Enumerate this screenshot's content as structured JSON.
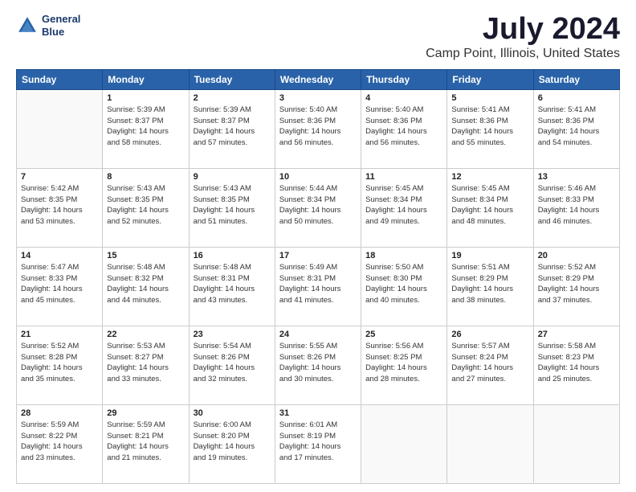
{
  "header": {
    "logo_line1": "General",
    "logo_line2": "Blue",
    "title": "July 2024",
    "subtitle": "Camp Point, Illinois, United States"
  },
  "weekdays": [
    "Sunday",
    "Monday",
    "Tuesday",
    "Wednesday",
    "Thursday",
    "Friday",
    "Saturday"
  ],
  "weeks": [
    [
      {
        "day": "",
        "info": ""
      },
      {
        "day": "1",
        "info": "Sunrise: 5:39 AM\nSunset: 8:37 PM\nDaylight: 14 hours\nand 58 minutes."
      },
      {
        "day": "2",
        "info": "Sunrise: 5:39 AM\nSunset: 8:37 PM\nDaylight: 14 hours\nand 57 minutes."
      },
      {
        "day": "3",
        "info": "Sunrise: 5:40 AM\nSunset: 8:36 PM\nDaylight: 14 hours\nand 56 minutes."
      },
      {
        "day": "4",
        "info": "Sunrise: 5:40 AM\nSunset: 8:36 PM\nDaylight: 14 hours\nand 56 minutes."
      },
      {
        "day": "5",
        "info": "Sunrise: 5:41 AM\nSunset: 8:36 PM\nDaylight: 14 hours\nand 55 minutes."
      },
      {
        "day": "6",
        "info": "Sunrise: 5:41 AM\nSunset: 8:36 PM\nDaylight: 14 hours\nand 54 minutes."
      }
    ],
    [
      {
        "day": "7",
        "info": "Sunrise: 5:42 AM\nSunset: 8:35 PM\nDaylight: 14 hours\nand 53 minutes."
      },
      {
        "day": "8",
        "info": "Sunrise: 5:43 AM\nSunset: 8:35 PM\nDaylight: 14 hours\nand 52 minutes."
      },
      {
        "day": "9",
        "info": "Sunrise: 5:43 AM\nSunset: 8:35 PM\nDaylight: 14 hours\nand 51 minutes."
      },
      {
        "day": "10",
        "info": "Sunrise: 5:44 AM\nSunset: 8:34 PM\nDaylight: 14 hours\nand 50 minutes."
      },
      {
        "day": "11",
        "info": "Sunrise: 5:45 AM\nSunset: 8:34 PM\nDaylight: 14 hours\nand 49 minutes."
      },
      {
        "day": "12",
        "info": "Sunrise: 5:45 AM\nSunset: 8:34 PM\nDaylight: 14 hours\nand 48 minutes."
      },
      {
        "day": "13",
        "info": "Sunrise: 5:46 AM\nSunset: 8:33 PM\nDaylight: 14 hours\nand 46 minutes."
      }
    ],
    [
      {
        "day": "14",
        "info": "Sunrise: 5:47 AM\nSunset: 8:33 PM\nDaylight: 14 hours\nand 45 minutes."
      },
      {
        "day": "15",
        "info": "Sunrise: 5:48 AM\nSunset: 8:32 PM\nDaylight: 14 hours\nand 44 minutes."
      },
      {
        "day": "16",
        "info": "Sunrise: 5:48 AM\nSunset: 8:31 PM\nDaylight: 14 hours\nand 43 minutes."
      },
      {
        "day": "17",
        "info": "Sunrise: 5:49 AM\nSunset: 8:31 PM\nDaylight: 14 hours\nand 41 minutes."
      },
      {
        "day": "18",
        "info": "Sunrise: 5:50 AM\nSunset: 8:30 PM\nDaylight: 14 hours\nand 40 minutes."
      },
      {
        "day": "19",
        "info": "Sunrise: 5:51 AM\nSunset: 8:29 PM\nDaylight: 14 hours\nand 38 minutes."
      },
      {
        "day": "20",
        "info": "Sunrise: 5:52 AM\nSunset: 8:29 PM\nDaylight: 14 hours\nand 37 minutes."
      }
    ],
    [
      {
        "day": "21",
        "info": "Sunrise: 5:52 AM\nSunset: 8:28 PM\nDaylight: 14 hours\nand 35 minutes."
      },
      {
        "day": "22",
        "info": "Sunrise: 5:53 AM\nSunset: 8:27 PM\nDaylight: 14 hours\nand 33 minutes."
      },
      {
        "day": "23",
        "info": "Sunrise: 5:54 AM\nSunset: 8:26 PM\nDaylight: 14 hours\nand 32 minutes."
      },
      {
        "day": "24",
        "info": "Sunrise: 5:55 AM\nSunset: 8:26 PM\nDaylight: 14 hours\nand 30 minutes."
      },
      {
        "day": "25",
        "info": "Sunrise: 5:56 AM\nSunset: 8:25 PM\nDaylight: 14 hours\nand 28 minutes."
      },
      {
        "day": "26",
        "info": "Sunrise: 5:57 AM\nSunset: 8:24 PM\nDaylight: 14 hours\nand 27 minutes."
      },
      {
        "day": "27",
        "info": "Sunrise: 5:58 AM\nSunset: 8:23 PM\nDaylight: 14 hours\nand 25 minutes."
      }
    ],
    [
      {
        "day": "28",
        "info": "Sunrise: 5:59 AM\nSunset: 8:22 PM\nDaylight: 14 hours\nand 23 minutes."
      },
      {
        "day": "29",
        "info": "Sunrise: 5:59 AM\nSunset: 8:21 PM\nDaylight: 14 hours\nand 21 minutes."
      },
      {
        "day": "30",
        "info": "Sunrise: 6:00 AM\nSunset: 8:20 PM\nDaylight: 14 hours\nand 19 minutes."
      },
      {
        "day": "31",
        "info": "Sunrise: 6:01 AM\nSunset: 8:19 PM\nDaylight: 14 hours\nand 17 minutes."
      },
      {
        "day": "",
        "info": ""
      },
      {
        "day": "",
        "info": ""
      },
      {
        "day": "",
        "info": ""
      }
    ]
  ]
}
